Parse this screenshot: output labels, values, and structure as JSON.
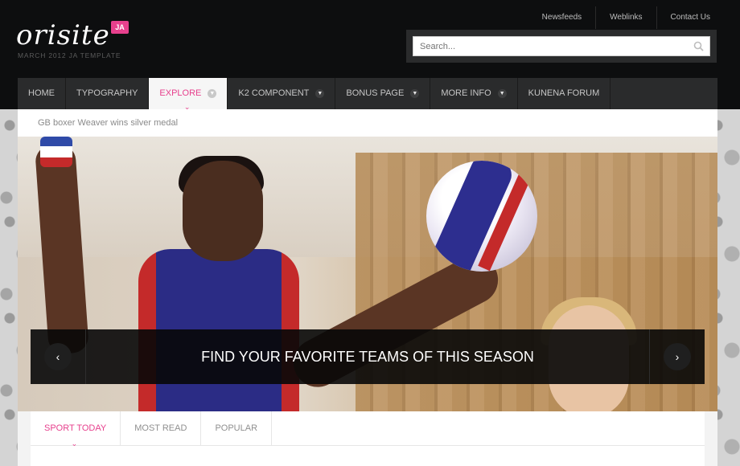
{
  "brand": {
    "logo_text": "orisite",
    "logo_badge": "JA",
    "tagline": "MARCH 2012 JA TEMPLATE"
  },
  "toplinks": [
    "Newsfeeds",
    "Weblinks",
    "Contact Us"
  ],
  "search": {
    "placeholder": "Search..."
  },
  "nav": [
    {
      "label": "HOME",
      "has_dropdown": false,
      "active": false
    },
    {
      "label": "TYPOGRAPHY",
      "has_dropdown": false,
      "active": false
    },
    {
      "label": "EXPLORE",
      "has_dropdown": true,
      "active": true
    },
    {
      "label": "K2 COMPONENT",
      "has_dropdown": true,
      "active": false
    },
    {
      "label": "BONUS PAGE",
      "has_dropdown": true,
      "active": false
    },
    {
      "label": "MORE INFO",
      "has_dropdown": true,
      "active": false
    },
    {
      "label": "KUNENA FORUM",
      "has_dropdown": false,
      "active": false
    }
  ],
  "ticker": {
    "text": "GB boxer Weaver wins silver medal"
  },
  "hero": {
    "caption": "FIND YOUR FAVORITE TEAMS OF THIS SEASON",
    "prev_icon": "‹",
    "next_icon": "›"
  },
  "tabs": [
    {
      "label": "SPORT TODAY",
      "active": true
    },
    {
      "label": "MOST READ",
      "active": false
    },
    {
      "label": "POPULAR",
      "active": false
    }
  ],
  "colors": {
    "accent": "#e7408d",
    "header_bg": "#0d0e0f",
    "nav_bg": "#2a2b2c"
  }
}
